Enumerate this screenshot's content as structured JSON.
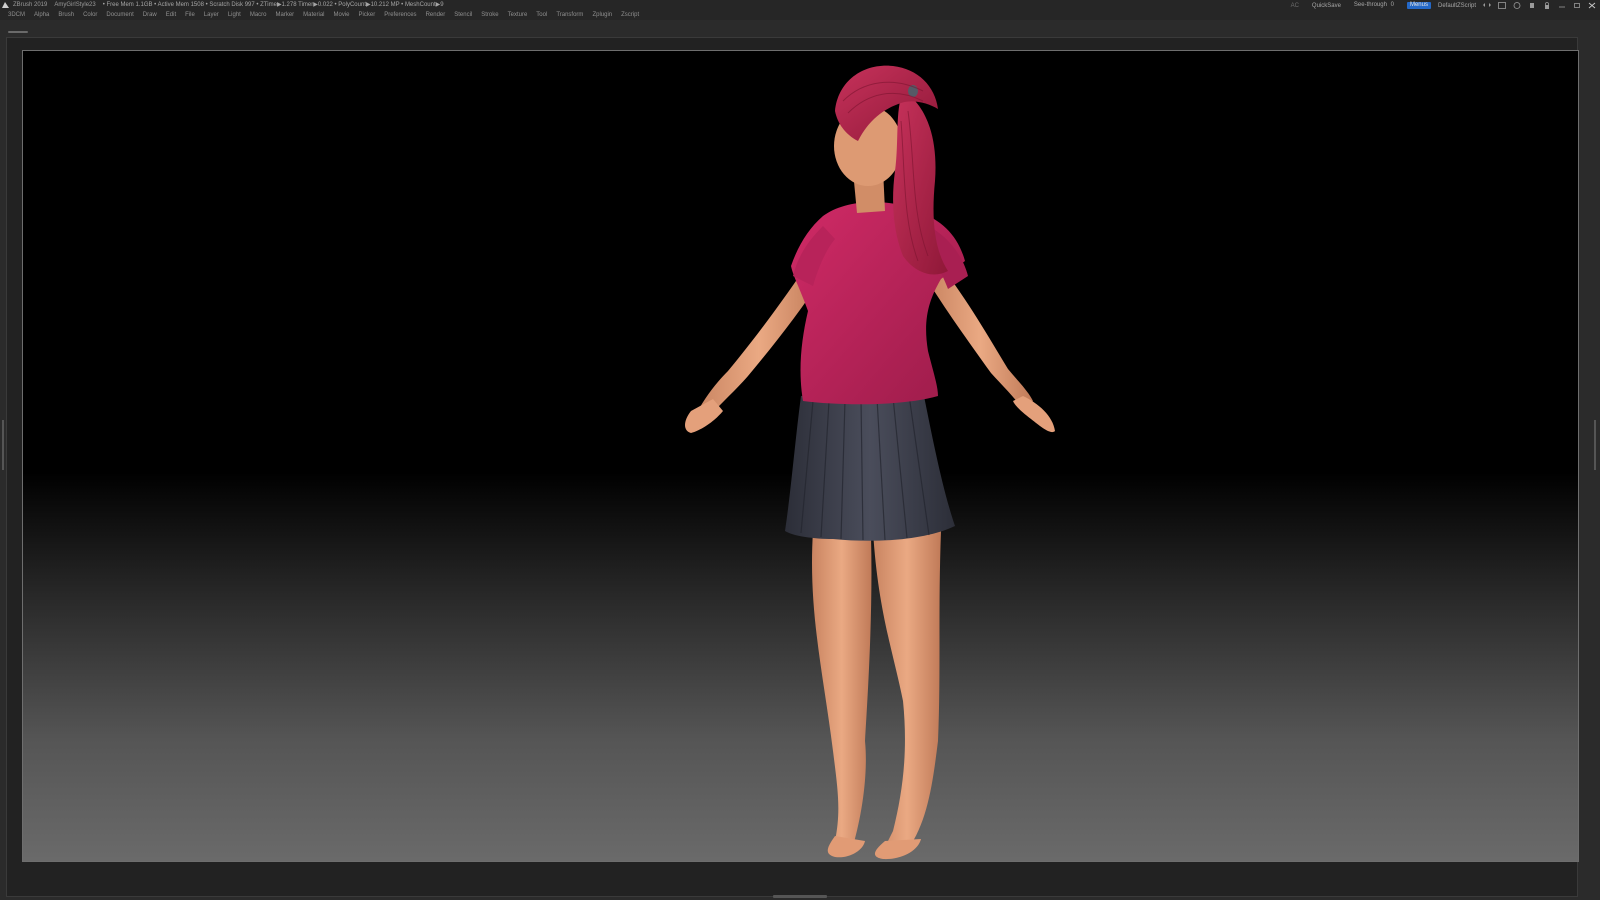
{
  "titlebar": {
    "app_name": "ZBrush 2019",
    "document": "AmyGirlStyle23",
    "stats": "• Free Mem 1.1GB • Active Mem 1508 • Scratch Disk 997 •  ZTime▶1.278 Timer▶0.022 • PolyCount▶10.212 MP  • MeshCount▶9",
    "ac_label": "AC",
    "quicksave_label": "QuickSave",
    "see_through_label": "See-through",
    "see_through_value": "0",
    "see_through_fraction": 0,
    "menus_badge": "Menus",
    "script_label": "DefaultZScript"
  },
  "menubar": {
    "items": [
      "3DCM",
      "Alpha",
      "Brush",
      "Color",
      "Document",
      "Draw",
      "Edit",
      "File",
      "Layer",
      "Light",
      "Macro",
      "Marker",
      "Material",
      "Movie",
      "Picker",
      "Preferences",
      "Render",
      "Stencil",
      "Stroke",
      "Texture",
      "Tool",
      "Transform",
      "Zplugin",
      "Zscript"
    ]
  },
  "colors": {
    "shirt": "#b8235a",
    "hair": "#b01f48",
    "skin": "#e9a27a",
    "skirt": "#3b3d4a",
    "accent": "#2468c7"
  }
}
